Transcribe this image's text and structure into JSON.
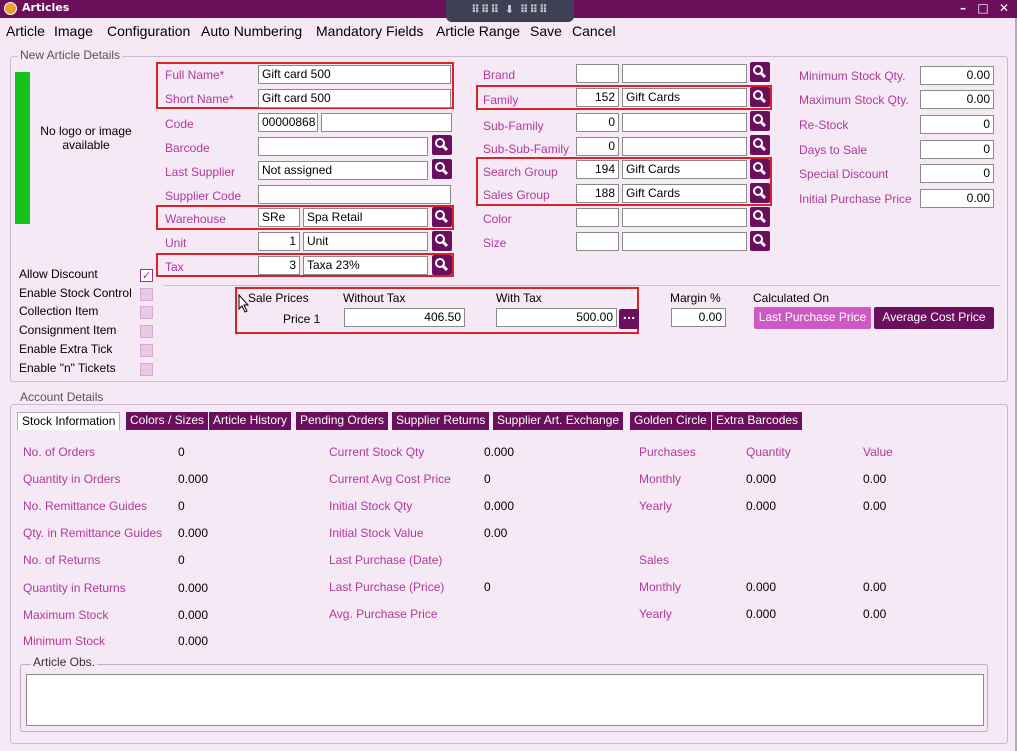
{
  "window": {
    "title": "Articles",
    "minimize": "–",
    "maximize": "□",
    "close": "✕"
  },
  "menu": [
    "Article",
    "Image",
    "Configuration",
    "Auto Numbering",
    "Mandatory Fields",
    "Article Range",
    "Save",
    "Cancel"
  ],
  "new_article": {
    "legend": "New Article Details",
    "logo_text": "No logo or image available",
    "full_name_label": "Full Name*",
    "full_name": "Gift card 500",
    "short_name_label": "Short Name*",
    "short_name": "Gift card 500",
    "code_label": "Code",
    "code": "00000868",
    "code2": "",
    "barcode_label": "Barcode",
    "barcode": "",
    "last_supplier_label": "Last Supplier",
    "last_supplier": "Not assigned",
    "supplier_code_label": "Supplier Code",
    "supplier_code": "",
    "warehouse_label": "Warehouse",
    "warehouse_code": "SRe",
    "warehouse_name": "Spa Retail",
    "unit_label": "Unit",
    "unit_code": "1",
    "unit_name": "Unit",
    "tax_label": "Tax",
    "tax_code": "3",
    "tax_name": "Taxa 23%",
    "brand_label": "Brand",
    "brand_code": "",
    "brand_name": "",
    "family_label": "Family",
    "family_code": "152",
    "family_name": "Gift Cards",
    "subfamily_label": "Sub-Family",
    "subfamily_code": "0",
    "subfamily_name": "",
    "subsubfamily_label": "Sub-Sub-Family",
    "subsubfamily_code": "0",
    "subsubfamily_name": "",
    "search_group_label": "Search Group",
    "search_group_code": "194",
    "search_group_name": "Gift Cards",
    "sales_group_label": "Sales Group",
    "sales_group_code": "188",
    "sales_group_name": "Gift Cards",
    "color_label": "Color",
    "color_code": "",
    "color_name": "",
    "size_label": "Size",
    "size_code": "",
    "size_name": "",
    "min_stock_label": "Minimum Stock Qty.",
    "min_stock": "0.00",
    "max_stock_label": "Maximum Stock Qty.",
    "max_stock": "0.00",
    "restock_label": "Re-Stock",
    "restock": "0",
    "days_to_sale_label": "Days to Sale",
    "days_to_sale": "0",
    "special_discount_label": "Special Discount",
    "special_discount": "0",
    "initial_purchase_label": "Initial Purchase Price",
    "initial_purchase": "0.00",
    "checkboxes": [
      {
        "label": "Allow Discount",
        "checked": true
      },
      {
        "label": "Enable Stock Control",
        "checked": false
      },
      {
        "label": "Collection Item",
        "checked": false
      },
      {
        "label": "Consignment Item",
        "checked": false
      },
      {
        "label": "Enable Extra Tick",
        "checked": false
      },
      {
        "label": "Enable \"n\" Tickets",
        "checked": false
      }
    ],
    "sale_prices_label": "Sale Prices",
    "without_tax_label": "Without Tax",
    "with_tax_label": "With Tax",
    "price1_label": "Price 1",
    "price1_without": "406.50",
    "price1_with": "500.00",
    "ellipsis": "...",
    "margin_label": "Margin %",
    "margin": "0.00",
    "calculated_on_label": "Calculated On",
    "last_purchase_btn": "Last Purchase Price",
    "avg_cost_btn": "Average Cost Price"
  },
  "account": {
    "legend": "Account Details",
    "tabs": [
      "Stock Information",
      "Colors / Sizes",
      "Article History",
      "Pending Orders",
      "Supplier Returns",
      "Supplier Art. Exchange",
      "Golden Circle",
      "Extra Barcodes"
    ],
    "col1": [
      {
        "label": "No. of Orders",
        "value": "0"
      },
      {
        "label": "Quantity in Orders",
        "value": "0.000"
      },
      {
        "label": "No. Remittance Guides",
        "value": "0"
      },
      {
        "label": "Qty. in Remittance Guides",
        "value": "0.000"
      },
      {
        "label": "No. of Returns",
        "value": "0"
      },
      {
        "label": "Quantity in Returns",
        "value": "0.000"
      },
      {
        "label": "Maximum Stock",
        "value": "0.000"
      },
      {
        "label": "Minimum Stock",
        "value": "0.000"
      }
    ],
    "col2": [
      {
        "label": "Current Stock Qty",
        "value": "0.000"
      },
      {
        "label": "Current Avg Cost Price",
        "value": "0"
      },
      {
        "label": "Initial Stock Qty",
        "value": "0.000"
      },
      {
        "label": "Initial Stock Value",
        "value": "0.00"
      },
      {
        "label": "Last Purchase (Date)",
        "value": ""
      },
      {
        "label": "Last Purchase (Price)",
        "value": "0"
      },
      {
        "label": "Avg. Purchase Price",
        "value": ""
      }
    ],
    "purchases_label": "Purchases",
    "quantity_label": "Quantity",
    "value_label": "Value",
    "purch_monthly_label": "Monthly",
    "purch_monthly_qty": "0.000",
    "purch_monthly_val": "0.00",
    "purch_yearly_label": "Yearly",
    "purch_yearly_qty": "0.000",
    "purch_yearly_val": "0.00",
    "sales_label": "Sales",
    "sales_monthly_label": "Monthly",
    "sales_monthly_qty": "0.000",
    "sales_monthly_val": "0.00",
    "sales_yearly_label": "Yearly",
    "sales_yearly_qty": "0.000",
    "sales_yearly_val": "0.00",
    "obs_legend": "Article Obs.",
    "obs": ""
  }
}
